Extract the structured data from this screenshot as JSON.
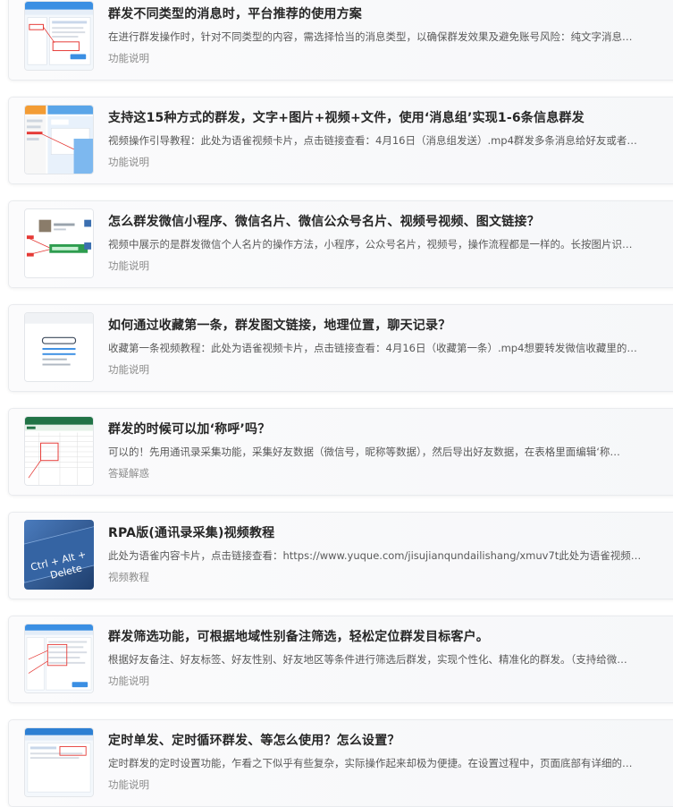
{
  "items": [
    {
      "title": "群发不同类型的消息时，平台推荐的使用方案",
      "desc": "在进行群发操作时，针对不同类型的内容，需选择恰当的消息类型，以确保群发效果及避免账号风险：纯文字消息…",
      "tag": "功能说明",
      "thumb": "screenshot-thumbnail"
    },
    {
      "title": "支持这15种方式的群发，文字+图片+视频+文件，使用‘消息组’实现1-6条信息群发",
      "desc": "视频操作引导教程：此处为语雀视频卡片，点击链接查看：4月16日（消息组发送）.mp4群发多条消息给好友或者…",
      "tag": "功能说明",
      "thumb": "screenshot-thumbnail"
    },
    {
      "title": "怎么群发微信小程序、微信名片、微信公众号名片、视频号视频、图文链接？",
      "desc": "视频中展示的是群发微信个人名片的操作方法，小程序，公众号名片，视频号，操作流程都是一样的。长按图片识…",
      "tag": "功能说明",
      "thumb": "screenshot-thumbnail"
    },
    {
      "title": "如何通过收藏第一条，群发图文链接，地理位置，聊天记录？",
      "desc": "收藏第一条视频教程：此处为语雀视频卡片，点击链接查看：4月16日（收藏第一条）.mp4想要转发微信收藏里的…",
      "tag": "功能说明",
      "thumb": "document-placeholder-thumbnail"
    },
    {
      "title": "群发的时候可以加‘称呼’吗？",
      "desc": "可以的！先用通讯录采集功能，采集好友数据（微信号，昵称等数据），然后导出好友数据，在表格里面编辑‘称…",
      "tag": "答疑解惑",
      "thumb": "spreadsheet-thumbnail"
    },
    {
      "title": "RPA版(通讯录采集)视频教程",
      "desc": "此处为语雀内容卡片，点击链接查看：https://www.yuque.com/jisujianqundailishang/xmuv7t此处为语雀视频…",
      "tag": "视频教程",
      "thumb": "keyboard-thumbnail",
      "thumb_text": [
        "Ctrl + Alt +",
        "Delete"
      ]
    },
    {
      "title": "群发筛选功能，可根据地域性别备注筛选，轻松定位群发目标客户。",
      "desc": "根据好友备注、好友标签、好友性别、好友地区等条件进行筛选后群发，实现个性化、精准化的群发。（支持给微…",
      "tag": "功能说明",
      "thumb": "screenshot-thumbnail"
    },
    {
      "title": "定时单发、定时循环群发、等怎么使用？怎么设置？",
      "desc": "定时群发的定时设置功能，乍看之下似乎有些复杂，实际操作起来却极为便捷。在设置过程中，页面底部有详细的…",
      "tag": "功能说明",
      "thumb": "screenshot-thumbnail"
    }
  ],
  "colors": {
    "title": "#262626",
    "desc": "#595959",
    "tag": "#8c8c8c",
    "accent_blue": "#3b8fe3",
    "accent_red": "#e53935",
    "keyboard_blue": "#2f5d9a"
  }
}
